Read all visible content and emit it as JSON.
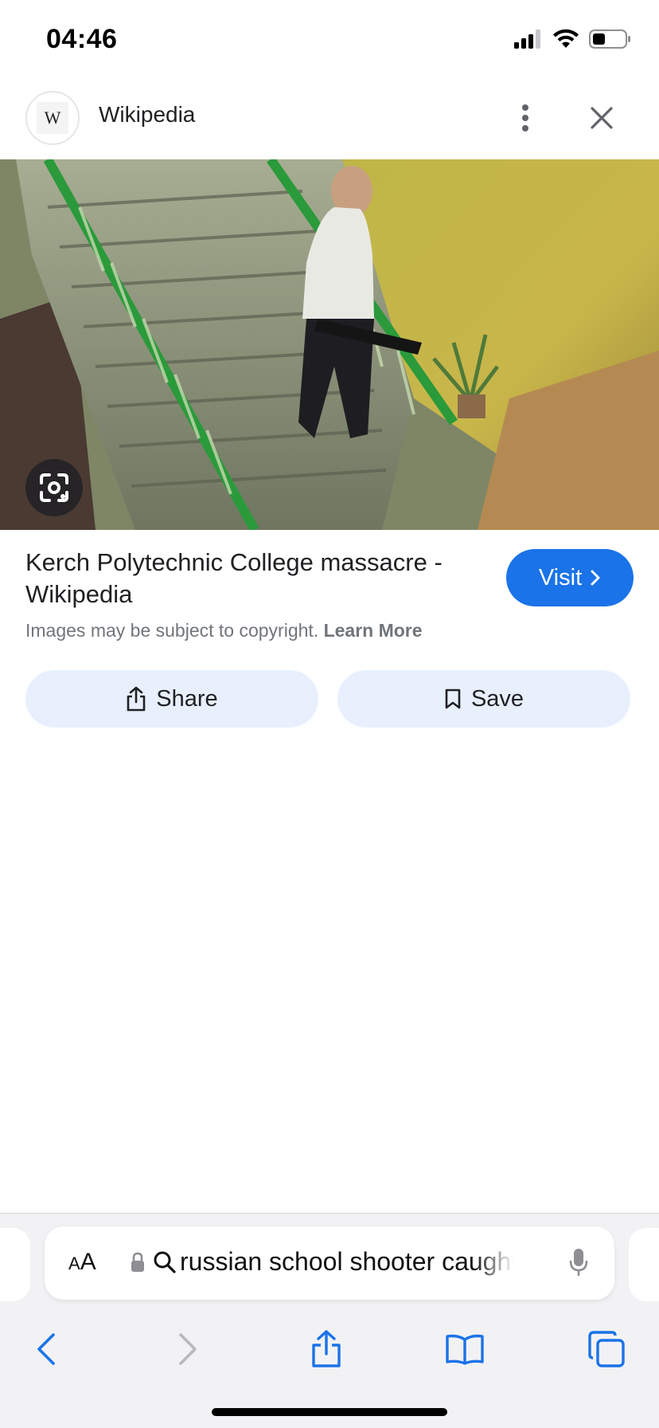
{
  "status_bar": {
    "time": "04:46",
    "icons": [
      "cellular-signal-icon",
      "wifi-icon",
      "battery-icon"
    ]
  },
  "header": {
    "logo_letter": "W",
    "site_name": "Wikipedia",
    "icons": [
      "more-vert-icon",
      "close-icon"
    ]
  },
  "image": {
    "description_icon": "lens-icon"
  },
  "result": {
    "title": "Kerch Polytechnic College massacre - Wikipedia",
    "visit_label": "Visit",
    "copyright_text": "Images may be subject to copyright.",
    "learn_more": "Learn More"
  },
  "actions": {
    "share_label": "Share",
    "save_label": "Save"
  },
  "browser": {
    "aa_large": "A",
    "aa_small": "A",
    "url_text": "russian school shooter caught",
    "toolbar_icons": [
      "back-icon",
      "forward-icon",
      "share-icon",
      "bookmarks-icon",
      "tabs-icon"
    ]
  },
  "colors": {
    "accent": "#1a73e8",
    "action_bg": "#e8f0fe",
    "toolbar_blue": "#1a73e8",
    "disabled_gray": "#b8b8bd"
  }
}
